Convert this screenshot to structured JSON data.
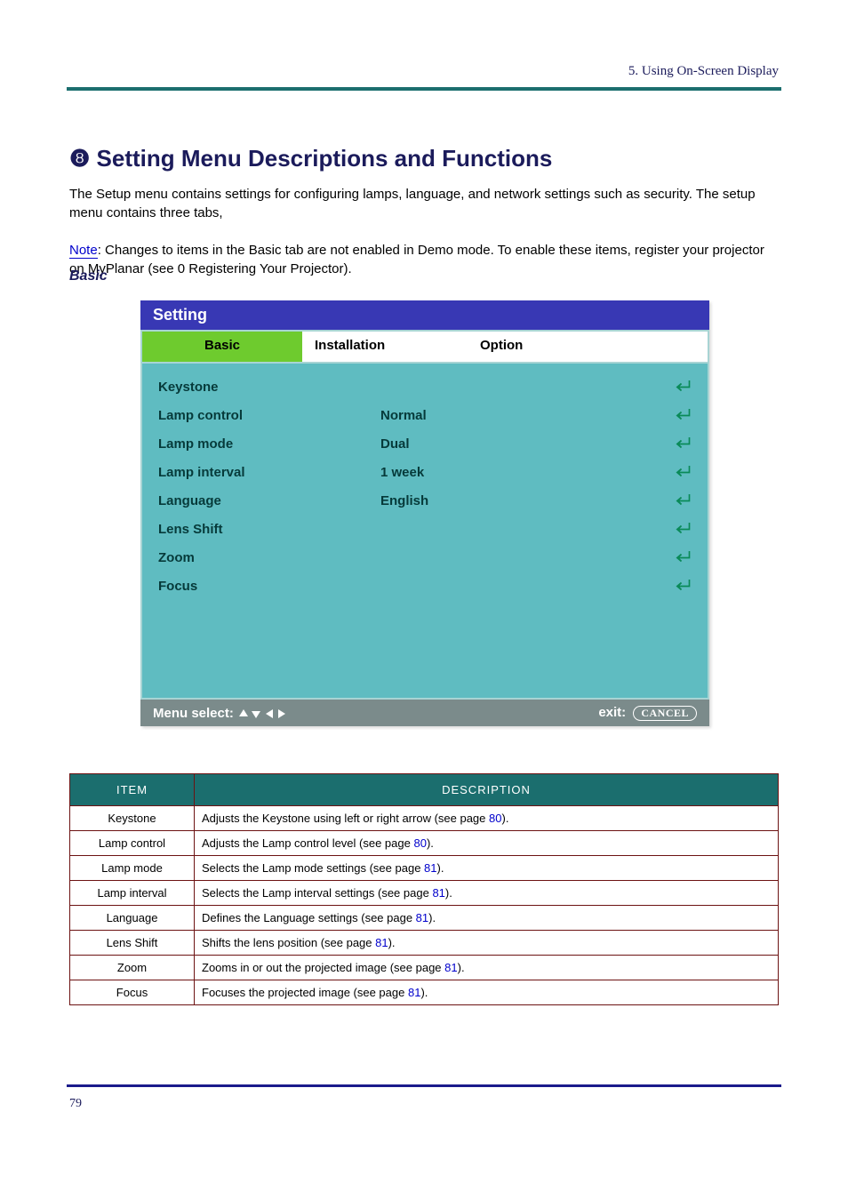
{
  "header": {
    "running_head": "5. Using On-Screen Display",
    "section_title": "❽ Setting Menu Descriptions and Functions",
    "body_text_1": "The Setup menu contains settings for configuring lamps, language, and network settings such as security. The setup menu contains three tabs, ",
    "body_text_link": "Note",
    "body_text_2": ": Changes to items in the Basic tab are not enabled in Demo mode. To enable these items, register your projector on MyPlanar (see ",
    "body_text_page": "0",
    "body_text_3": " Registering Your Projector).",
    "sub_heading": "Basic"
  },
  "osd": {
    "title": "Setting",
    "tabs": {
      "basic": "Basic",
      "installation": "Installation",
      "option": "Option"
    },
    "rows": [
      {
        "label": "Keystone",
        "value": ""
      },
      {
        "label": "Lamp control",
        "value": "Normal"
      },
      {
        "label": "Lamp mode",
        "value": "Dual"
      },
      {
        "label": "Lamp interval",
        "value": "1 week"
      },
      {
        "label": "Language",
        "value": "English"
      },
      {
        "label": "Lens Shift",
        "value": ""
      },
      {
        "label": "Zoom",
        "value": ""
      },
      {
        "label": "Focus",
        "value": ""
      }
    ],
    "footer": {
      "menu_select": "Menu select:",
      "exit": "exit:",
      "cancel": "CANCEL"
    }
  },
  "table": {
    "headers": {
      "item": "ITEM",
      "description": "DESCRIPTION"
    },
    "rows": [
      {
        "item": "Keystone",
        "desc1": "Adjusts the Keystone using left or right arrow (see page ",
        "page": "80",
        "desc2": ")."
      },
      {
        "item": "Lamp control",
        "desc1": "Adjusts the Lamp control level (see page ",
        "page": "80",
        "desc2": ")."
      },
      {
        "item": "Lamp mode",
        "desc1": "Selects the Lamp mode settings (see page ",
        "page": "81",
        "desc2": ")."
      },
      {
        "item": "Lamp interval",
        "desc1": "Selects the Lamp interval settings (see page ",
        "page": "81",
        "desc2": ")."
      },
      {
        "item": "Language",
        "desc1": "Defines the Language settings (see page ",
        "page": "81",
        "desc2": ")."
      },
      {
        "item": "Lens Shift",
        "desc1": "Shifts the lens position (see page ",
        "page": "81",
        "desc2": ")."
      },
      {
        "item": "Zoom",
        "desc1": "Zooms in or out the projected image (see page ",
        "page": "81",
        "desc2": ")."
      },
      {
        "item": "Focus",
        "desc1": "Focuses the projected image (see page ",
        "page": "81",
        "desc2": ")."
      }
    ]
  },
  "footer": {
    "page_number": "79"
  }
}
